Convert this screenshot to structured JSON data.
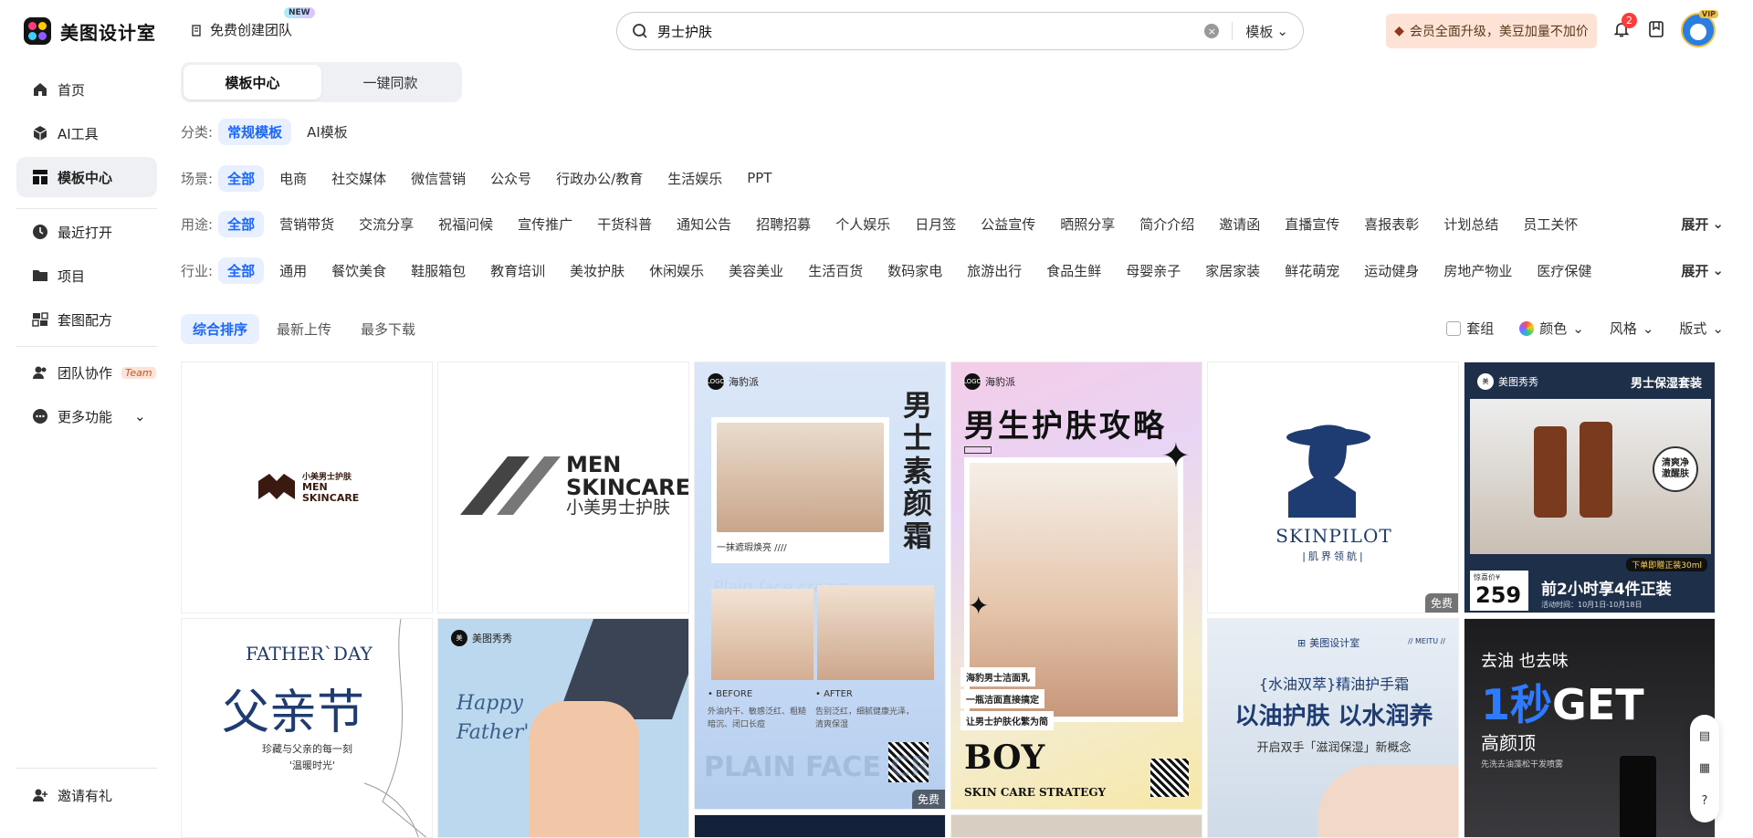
{
  "header": {
    "logo_text": "美图设计室",
    "team_button": "免费创建团队",
    "new_badge": "NEW",
    "search_value": "男士护肤",
    "search_type": "模板",
    "vip_banner": "会员全面升级，美豆加量不加价",
    "notification_count": "2",
    "vip_tag": "VIP"
  },
  "sidebar": {
    "items": [
      {
        "label": "首页"
      },
      {
        "label": "AI工具"
      },
      {
        "label": "模板中心"
      },
      {
        "label": "最近打开"
      },
      {
        "label": "项目"
      },
      {
        "label": "套图配方"
      },
      {
        "label": "团队协作"
      },
      {
        "label": "更多功能"
      }
    ],
    "team_tag": "Team",
    "invite": "邀请有礼"
  },
  "tabs": {
    "active": "模板中心",
    "other": "一键同款"
  },
  "filters": {
    "category_label": "分类:",
    "category": [
      "常规模板",
      "AI模板"
    ],
    "scene_label": "场景:",
    "scene": [
      "全部",
      "电商",
      "社交媒体",
      "微信营销",
      "公众号",
      "行政办公/教育",
      "生活娱乐",
      "PPT"
    ],
    "usage_label": "用途:",
    "usage": [
      "全部",
      "营销带货",
      "交流分享",
      "祝福问候",
      "宣传推广",
      "干货科普",
      "通知公告",
      "招聘招募",
      "个人娱乐",
      "日月签",
      "公益宣传",
      "晒照分享",
      "简介介绍",
      "邀请函",
      "直播宣传",
      "喜报表彰",
      "计划总结",
      "员工关怀"
    ],
    "industry_label": "行业:",
    "industry": [
      "全部",
      "通用",
      "餐饮美食",
      "鞋服箱包",
      "教育培训",
      "美妆护肤",
      "休闲娱乐",
      "美容美业",
      "生活百货",
      "数码家电",
      "旅游出行",
      "食品生鲜",
      "母婴亲子",
      "家居家装",
      "鲜花萌宠",
      "运动健身",
      "房地产物业",
      "医疗保健"
    ],
    "expand": "展开"
  },
  "sort": {
    "options": [
      "综合排序",
      "最新上传",
      "最多下载"
    ]
  },
  "tools": {
    "suite": "套组",
    "color": "颜色",
    "style": "风格",
    "format": "版式"
  },
  "cards": {
    "c1": {
      "cn": "小美男士护肤",
      "en1": "MEN",
      "en2": "SKINCARE"
    },
    "c2": {
      "en1": "MEN",
      "en2": "SKINCARE",
      "cn": "小美男士护肤"
    },
    "c3": {
      "brand": "海豹派",
      "title": "男士素颜霜",
      "caption": "一抹遮瑕焕亮 ////",
      "script": "Plain face cream",
      "before": "• BEFORE",
      "after": "• AFTER",
      "before_desc": "外油内干、敏感泛红、粗糙暗沉、闭口长痘",
      "after_desc": "告别泛红，细腻健康光泽，清爽保湿",
      "bottom": "PLAIN FACE CR",
      "free": "免费"
    },
    "c4": {
      "brand": "海豹派",
      "title": "男生护肤攻略",
      "t1": "海豹男士洁面乳",
      "t2": "一瓶洁面直接搞定",
      "t3": "让男士护肤化繁为简",
      "big": "BOY",
      "sub": "SKIN CARE STRATEGY"
    },
    "c5": {
      "name": "SKINPILOT",
      "cn": "|肌界领航|",
      "free": "免费"
    },
    "c6": {
      "brand": "美图秀秀",
      "title": "男士保湿套装",
      "badge": "清爽净澈醒肤",
      "tag": "下单即赠正装30ml",
      "price_label": "惊喜价¥",
      "price": "259",
      "promo": "前2小时享4件正装",
      "date": "活动时间：10月1日-10月18日"
    },
    "c7": {
      "title": "FATHER`DAY",
      "cn": "父亲节",
      "desc1": "珍藏与父亲的每一刻",
      "desc2": "'温暖时光'"
    },
    "c8": {
      "brand": "美图秀秀",
      "script1": "Happy",
      "script2": "Father's Day"
    },
    "c9": {
      "brand": "美图设计室",
      "tag": "// MEITU //",
      "brand2": "水油双萃",
      "title1": "{水油双萃}精油护手霜",
      "title2": "以油护肤 以水润养",
      "sub": "开启双手「滋润保湿」新概念"
    },
    "c10": {
      "l1": "去油 也去味",
      "big1": "1秒",
      "big2": "GET",
      "l2": "高颜顶",
      "l3": "先洗去油藻松干发喷雾"
    }
  },
  "float_bar": {
    "help": "?"
  }
}
